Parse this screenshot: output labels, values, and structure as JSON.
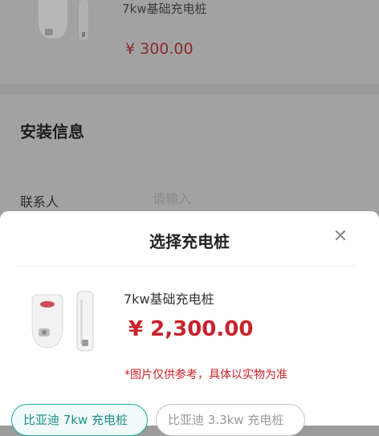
{
  "background": {
    "product_name": "7kw基础充电桩",
    "product_price": "¥ 300.00",
    "section_title": "安装信息",
    "contact_label": "联系人",
    "contact_placeholder": "请输入"
  },
  "sheet": {
    "title": "选择充电桩",
    "close_icon": "close-icon",
    "product": {
      "name": "7kw基础充电桩",
      "price": "¥ 2,300.00",
      "note": "*图片仅供参考，具体以实物为准"
    },
    "options": [
      {
        "label": "比亚迪 7kw 充电桩",
        "selected": true
      },
      {
        "label": "比亚迪 3.3kw 充电桩",
        "selected": false
      }
    ]
  },
  "colors": {
    "accent": "#1fa9a1",
    "price": "#c8232c",
    "overlay": "#9b9b9b"
  }
}
